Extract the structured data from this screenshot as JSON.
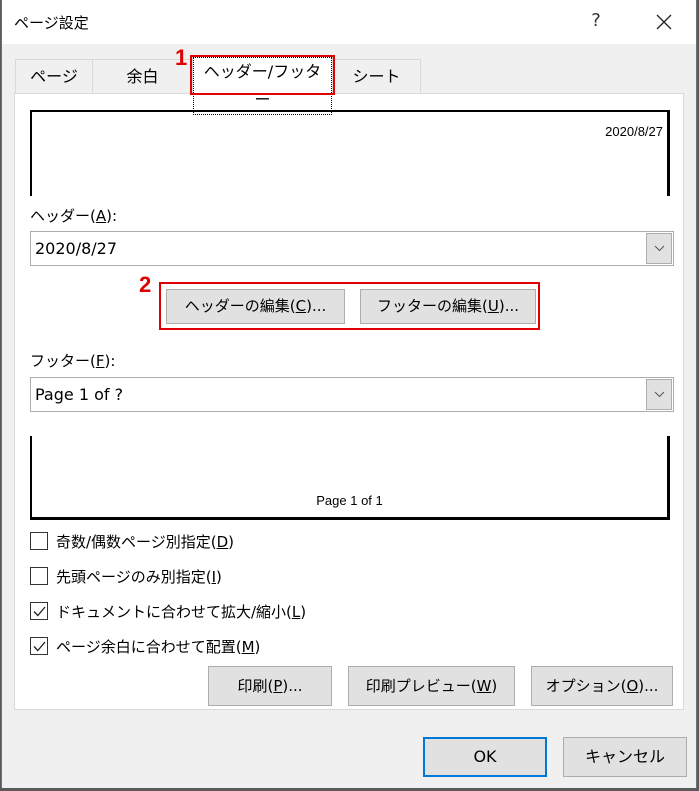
{
  "window": {
    "title": "ページ設定",
    "help_label": "?",
    "close_icon": "close-icon"
  },
  "tabs": [
    {
      "label": "ページ",
      "active": false
    },
    {
      "label": "余白",
      "active": false
    },
    {
      "label": "ヘッダー/フッター",
      "active": true
    },
    {
      "label": "シート",
      "active": false
    }
  ],
  "annotations": {
    "marker1": "1",
    "marker2": "2",
    "highlight_color": "#e00000"
  },
  "header_preview": {
    "text": "2020/8/27"
  },
  "header": {
    "label_prefix": "ヘッダー(",
    "label_key": "A",
    "label_suffix": "):",
    "value": "2020/8/27"
  },
  "edit_buttons": {
    "header_edit_prefix": "ヘッダーの編集(",
    "header_edit_key": "C",
    "header_edit_suffix": ")...",
    "footer_edit_prefix": "フッターの編集(",
    "footer_edit_key": "U",
    "footer_edit_suffix": ")..."
  },
  "footer": {
    "label_prefix": "フッター(",
    "label_key": "F",
    "label_suffix": "):",
    "value": "Page 1 of ?"
  },
  "footer_preview": {
    "text": "Page 1 of 1"
  },
  "options": [
    {
      "prefix": "奇数/偶数ページ別指定(",
      "key": "D",
      "suffix": ")",
      "checked": false
    },
    {
      "prefix": "先頭ページのみ別指定(",
      "key": "I",
      "suffix": ")",
      "checked": false
    },
    {
      "prefix": "ドキュメントに合わせて拡大/縮小(",
      "key": "L",
      "suffix": ")",
      "checked": true
    },
    {
      "prefix": "ページ余白に合わせて配置(",
      "key": "M",
      "suffix": ")",
      "checked": true
    }
  ],
  "action_buttons": {
    "print_prefix": "印刷(",
    "print_key": "P",
    "print_suffix": ")...",
    "preview_prefix": "印刷プレビュー(",
    "preview_key": "W",
    "preview_suffix": ")",
    "options_prefix": "オプション(",
    "options_key": "O",
    "options_suffix": ")..."
  },
  "dialog_buttons": {
    "ok": "OK",
    "cancel": "キャンセル"
  },
  "colors": {
    "focus_border": "#0078d7",
    "button_face": "#e1e1e1",
    "dialog_bg": "#f0f0f0"
  }
}
